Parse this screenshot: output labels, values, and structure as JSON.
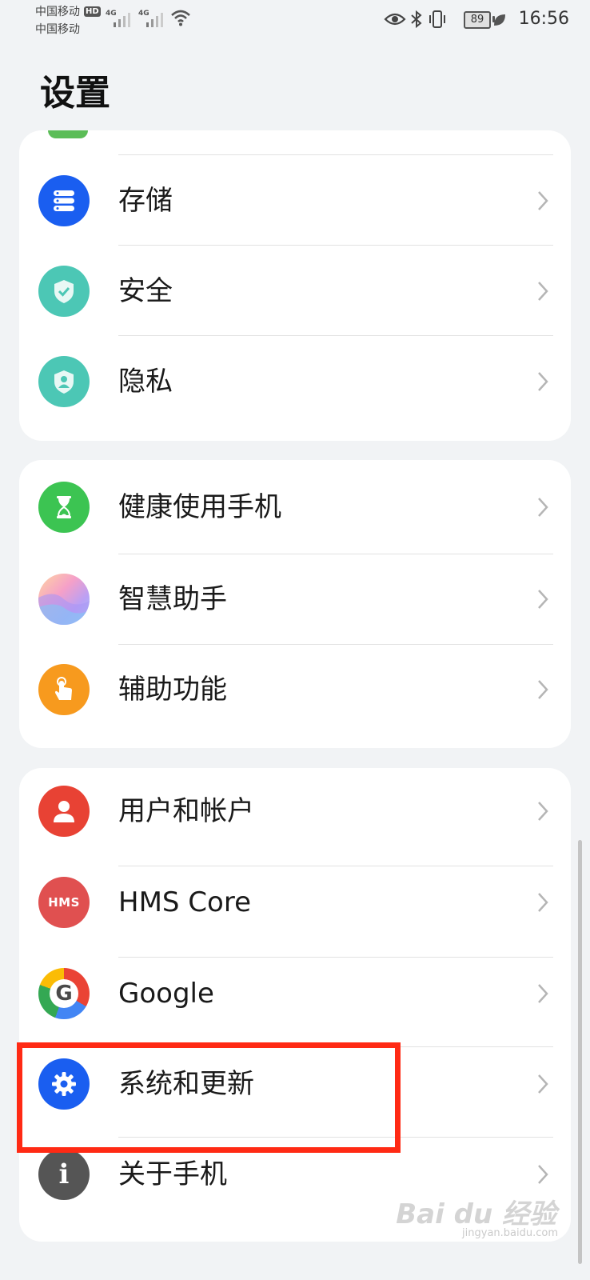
{
  "status_bar": {
    "carrier_1": "中国移动",
    "carrier_2": "中国移动",
    "hd_badge": "HD",
    "network_1": "4G",
    "network_2": "4G",
    "battery": "89",
    "time": "16:56"
  },
  "page_title": "设置",
  "groups": [
    {
      "items": [
        {
          "label": "存储",
          "icon": "storage-icon",
          "color": "#1a5ef0"
        },
        {
          "label": "安全",
          "icon": "security-shield-icon",
          "color": "#4cc7b5"
        },
        {
          "label": "隐私",
          "icon": "privacy-shield-icon",
          "color": "#4cc7b5"
        }
      ]
    },
    {
      "items": [
        {
          "label": "健康使用手机",
          "icon": "hourglass-icon",
          "color": "#3cc452"
        },
        {
          "label": "智慧助手",
          "icon": "assistant-icon",
          "color": "#c9a6f0"
        },
        {
          "label": "辅助功能",
          "icon": "accessibility-hand-icon",
          "color": "#f79a1e"
        }
      ]
    },
    {
      "items": [
        {
          "label": "用户和帐户",
          "icon": "user-icon",
          "color": "#e84234"
        },
        {
          "label": "HMS Core",
          "icon": "hms-icon",
          "color": "#e05050",
          "icon_text": "HMS"
        },
        {
          "label": "Google",
          "icon": "google-icon",
          "color": "#ffffff",
          "icon_text": "G"
        },
        {
          "label": "系统和更新",
          "icon": "gear-icon",
          "color": "#1a5ef0"
        },
        {
          "label": "关于手机",
          "icon": "info-icon",
          "color": "#555555",
          "icon_text": "i"
        }
      ]
    }
  ],
  "watermark": {
    "text": "Bai du 经验",
    "sub": "jingyan.baidu.com"
  },
  "highlight_color": "#ff2a14"
}
